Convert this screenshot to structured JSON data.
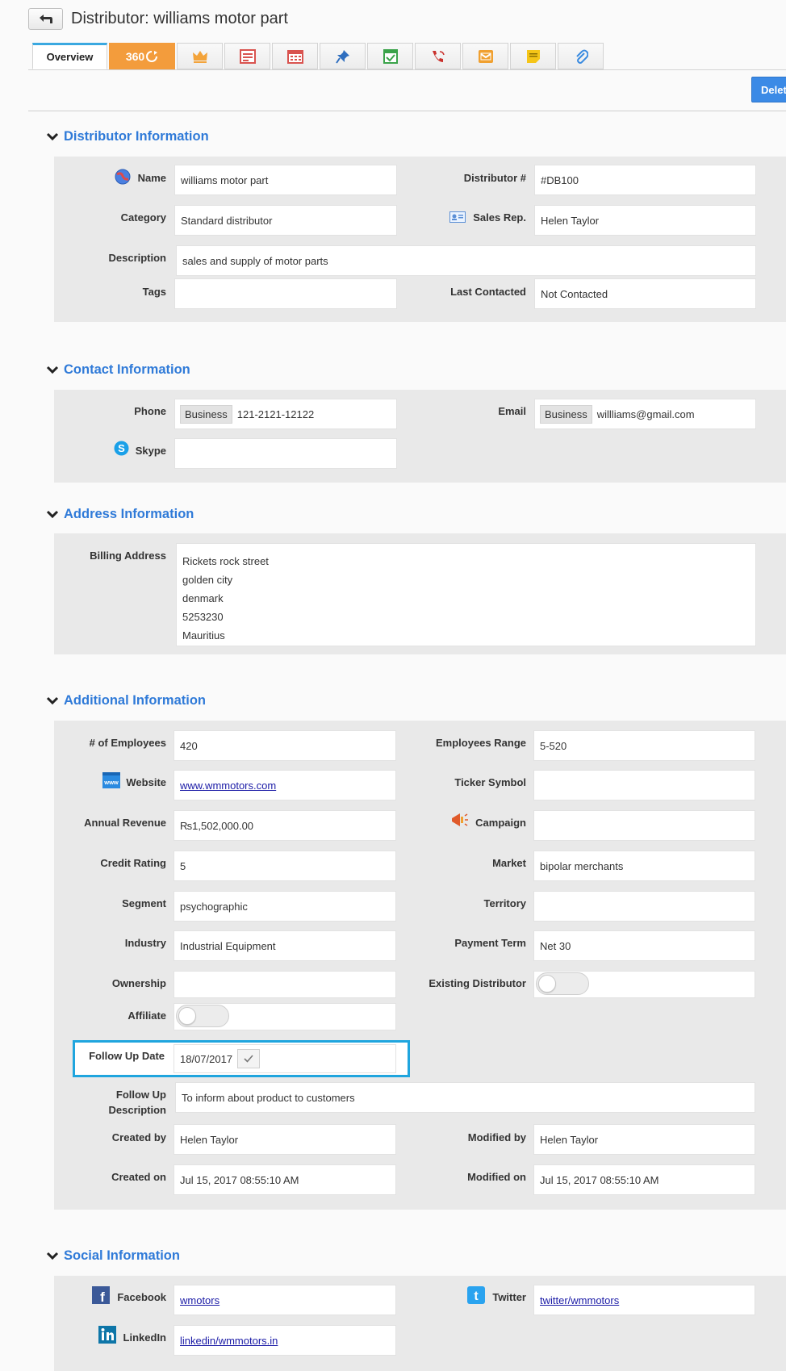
{
  "header": {
    "title": "Distributor: williams motor part",
    "back_icon": "back-arrow-icon"
  },
  "tabs": {
    "overview": "Overview",
    "t360": "360",
    "icons": [
      "crown-icon",
      "invoice-icon",
      "calendar-icon",
      "pin-icon",
      "task-icon",
      "call-icon",
      "mail-icon",
      "note-icon",
      "attachment-icon"
    ]
  },
  "actions": {
    "delete_label": "Delet"
  },
  "colors": {
    "accent": "#2f7ad8",
    "orange": "#f39c3c",
    "delete_blue": "#3b8ae6",
    "highlight": "#1fa5de"
  },
  "distributor_info": {
    "title": "Distributor Information",
    "name_label": "Name",
    "name_value": "williams motor part",
    "number_label": "Distributor #",
    "number_value": "#DB100",
    "category_label": "Category",
    "category_value": "Standard distributor",
    "salesrep_label": "Sales Rep.",
    "salesrep_value": "Helen Taylor",
    "description_label": "Description",
    "description_value": "sales and supply of motor parts",
    "tags_label": "Tags",
    "tags_value": "",
    "lastcontacted_label": "Last Contacted",
    "lastcontacted_value": "Not Contacted"
  },
  "contact_info": {
    "title": "Contact Information",
    "phone_label": "Phone",
    "phone_type": "Business",
    "phone_value": "121-2121-12122",
    "email_label": "Email",
    "email_type": "Business",
    "email_value": "willliams@gmail.com",
    "skype_label": "Skype",
    "skype_value": ""
  },
  "address_info": {
    "title": "Address Information",
    "billing_label": "Billing Address",
    "lines": [
      "Rickets rock street",
      "golden city",
      "denmark",
      "5253230",
      "Mauritius"
    ]
  },
  "additional_info": {
    "title": "Additional Information",
    "employees_label": "# of Employees",
    "employees_value": "420",
    "range_label": "Employees Range",
    "range_value": "5-520",
    "website_label": "Website",
    "website_value": "www.wmmotors.com",
    "ticker_label": "Ticker Symbol",
    "ticker_value": "",
    "revenue_label": "Annual Revenue",
    "revenue_value": "₨1,502,000.00",
    "campaign_label": "Campaign",
    "campaign_value": "",
    "credit_label": "Credit Rating",
    "credit_value": "5",
    "market_label": "Market",
    "market_value": "bipolar merchants",
    "segment_label": "Segment",
    "segment_value": "psychographic",
    "territory_label": "Territory",
    "territory_value": "",
    "industry_label": "Industry",
    "industry_value": "Industrial Equipment",
    "payment_label": "Payment Term",
    "payment_value": "Net 30",
    "ownership_label": "Ownership",
    "ownership_value": "",
    "existing_label": "Existing Distributor",
    "existing_on": false,
    "affiliate_label": "Affiliate",
    "affiliate_on": false,
    "followup_label": "Follow Up Date",
    "followup_value": "18/07/2017",
    "followup_desc_label_1": "Follow Up",
    "followup_desc_label_2": "Description",
    "followup_desc_value": "To inform about product to customers",
    "createdby_label": "Created by",
    "createdby_value": "Helen Taylor",
    "modifiedby_label": "Modified by",
    "modifiedby_value": "Helen Taylor",
    "createdon_label": "Created on",
    "createdon_value": "Jul 15, 2017 08:55:10 AM",
    "modifiedon_label": "Modified on",
    "modifiedon_value": "Jul 15, 2017 08:55:10 AM"
  },
  "social_info": {
    "title": "Social Information",
    "facebook_label": "Facebook",
    "facebook_value": "wmotors",
    "twitter_label": "Twitter",
    "twitter_value": "twitter/wmmotors",
    "linkedin_label": "LinkedIn",
    "linkedin_value": "linkedin/wmmotors.in"
  }
}
